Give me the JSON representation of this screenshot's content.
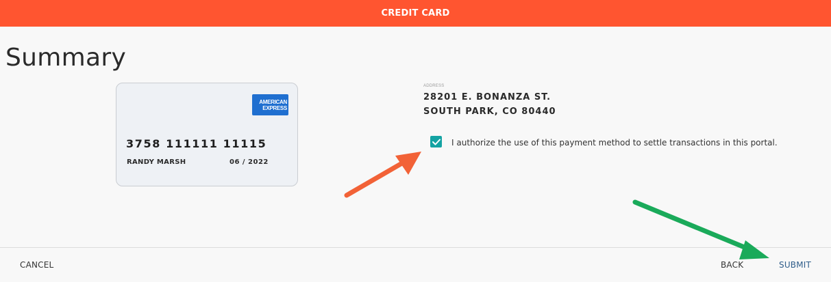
{
  "header": {
    "title": "CREDIT CARD"
  },
  "page": {
    "title": "Summary"
  },
  "card": {
    "brand_logo_lines": [
      "AMERICAN",
      "EXPRESS"
    ],
    "number": "3758 111111 11115",
    "holder": "RANDY MARSH",
    "expiry": "06 / 2022",
    "brand_color": "#1f6fd0"
  },
  "address": {
    "label": "ADDRESS",
    "line1": "28201 E. BONANZA ST.",
    "line2": "SOUTH PARK, CO 80440"
  },
  "authorization": {
    "checked": true,
    "text": "I authorize the use of this payment method to settle transactions in this portal.",
    "checkbox_color": "#14a3a3"
  },
  "footer": {
    "cancel_label": "CANCEL",
    "back_label": "BACK",
    "submit_label": "SUBMIT"
  },
  "annotations": {
    "orange_arrow_color": "#f26237",
    "green_arrow_color": "#1aaa5a"
  },
  "colors": {
    "header_bg": "#ff5530",
    "submit_text": "#2f5d8a"
  }
}
